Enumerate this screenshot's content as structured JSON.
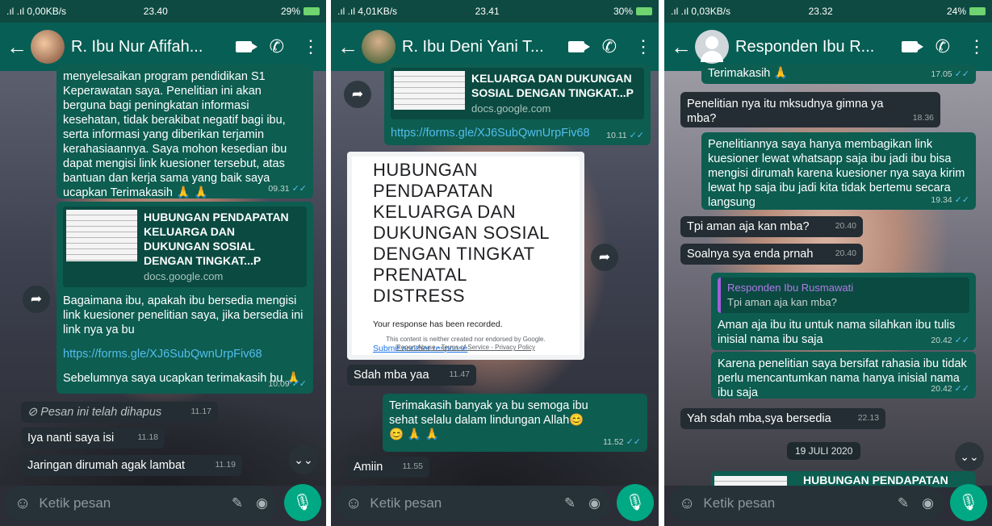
{
  "screens": [
    {
      "status": {
        "signal": ".ıl .ıl 0,00KB/s",
        "time": "23.40",
        "battery": "29%"
      },
      "chat": {
        "title": "R. Ibu Nur Afifah..."
      },
      "messages": {
        "m1": {
          "text": "menyelesaikan program pendidikan S1 Keperawatan saya.  Penelitian ini akan berguna bagi peningkatan informasi kesehatan, tidak berakibat negatif bagi ibu, serta informasi yang diberikan terjamin kerahasiaannya.  Saya mohon kesedian ibu dapat mengisi link kuesioner tersebut, atas bantuan dan kerja sama yang baik saya ucapkan Terimakasih 🙏 🙏",
          "time": "09.31"
        },
        "m2": {
          "preview_title": "HUBUNGAN PENDAPATAN KELUARGA DAN DUKUNGAN SOSIAL DENGAN TINGKAT...P",
          "preview_domain": "docs.google.com",
          "text": "Bagaimana ibu, apakah ibu bersedia mengisi link kuesioner penelitian saya, jika bersedia ini link nya ya bu",
          "link": "https://forms.gle/XJ6SubQwnUrpFiv68",
          "text2": "Sebelumnya saya ucapkan terimakasih bu 🙏",
          "time": "10.09"
        },
        "m3": {
          "text": "Pesan ini telah dihapus",
          "time": "11.17"
        },
        "m4": {
          "text": "Iya nanti saya isi",
          "time": "11.18"
        },
        "m5": {
          "text": "Jaringan dirumah agak lambat",
          "time": "11.19"
        }
      },
      "input": {
        "placeholder": "Ketik pesan"
      }
    },
    {
      "status": {
        "signal": ".ıl .ıl 4,01KB/s",
        "time": "23.41",
        "battery": "30%"
      },
      "chat": {
        "title": "R. Ibu Deni Yani T..."
      },
      "messages": {
        "m1": {
          "preview_title": "KELUARGA DAN DUKUNGAN SOSIAL DENGAN TINGKAT...P",
          "preview_domain": "docs.google.com",
          "link": "https://forms.gle/XJ6SubQwnUrpFiv68",
          "time": "10.11"
        },
        "form": {
          "title": "HUBUNGAN PENDAPATAN KELUARGA DAN DUKUNGAN SOSIAL DENGAN TINGKAT PRENATAL DISTRESS",
          "response": "Your response has been recorded.",
          "submit": "Submit another response",
          "footer": "This content is neither created nor endorsed by Google.",
          "footer_links": "Report Abuse - Terms of Service - Privacy Policy",
          "time": "11.47"
        },
        "m2": {
          "text": "Sdah mba yaa",
          "time": "11.47"
        },
        "m3": {
          "text": "Terimakasih banyak ya bu semoga ibu sehat selalu dalam lindungan Allah😊😊 🙏 🙏",
          "time": "11.52"
        },
        "m4": {
          "text": "Amiin",
          "time": "11.55"
        }
      },
      "input": {
        "placeholder": "Ketik pesan"
      }
    },
    {
      "status": {
        "signal": ".ıl .ıl 0,03KB/s",
        "time": "23.32",
        "battery": "24%"
      },
      "chat": {
        "title": "Responden Ibu R..."
      },
      "messages": {
        "m0": {
          "text": "Terimakasih 🙏",
          "time": "17.05"
        },
        "m1": {
          "text": "Penelitian nya itu mksudnya gimna ya mba?",
          "time": "18.36"
        },
        "m2": {
          "text": "Penelitiannya saya hanya membagikan link kuesioner lewat whatsapp saja ibu jadi ibu bisa mengisi dirumah karena kuesioner nya saya kirim lewat hp saja ibu jadi kita tidak bertemu secara langsung",
          "time": "19.34"
        },
        "m3": {
          "text": "Tpi aman aja kan mba?",
          "time": "20.40"
        },
        "m4": {
          "text": "Soalnya sya enda prnah",
          "time": "20.40"
        },
        "m5": {
          "quote_name": "Responden Ibu Rusmawati",
          "quote_text": "Tpi aman aja kan mba?",
          "text": "Aman aja ibu itu untuk nama silahkan ibu tulis inisial nama ibu saja",
          "time": "20.42"
        },
        "m6": {
          "text": "Karena penelitian saya bersifat rahasia ibu tidak perlu mencantumkan nama hanya inisial nama ibu saja",
          "time": "20.42"
        },
        "m7": {
          "text": "Yah sdah mba,sya bersedia",
          "time": "22.13"
        },
        "date_chip": "19 JULI 2020",
        "m8": {
          "preview_title": "HUBUNGAN PENDAPATAN"
        }
      },
      "input": {
        "placeholder": "Ketik pesan"
      }
    }
  ]
}
